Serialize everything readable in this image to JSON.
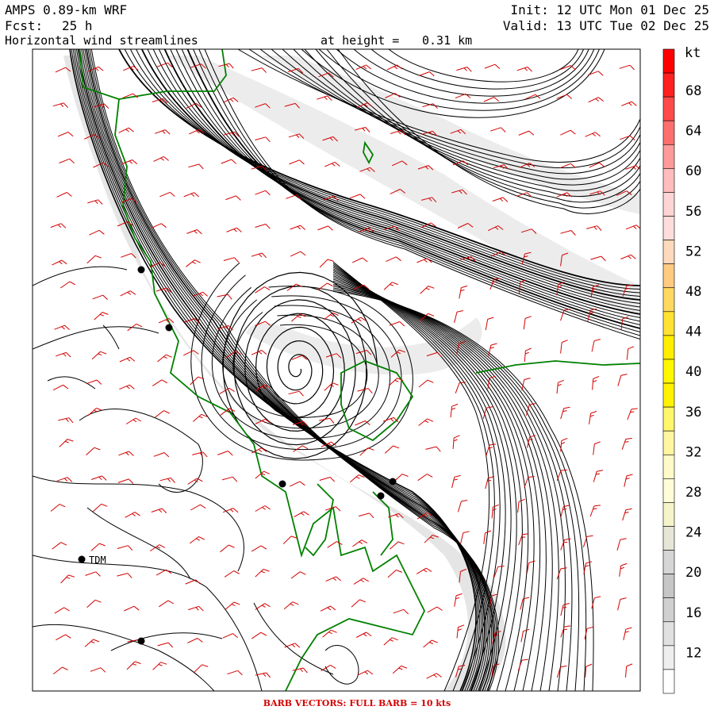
{
  "header": {
    "model": "AMPS 0.89-km WRF",
    "forecast_prefix": "Fcst:",
    "forecast_hours": "25 h",
    "field": "Horizontal wind streamlines",
    "height_prefix": "at height =",
    "height_value": "0.31 km",
    "init": "Init: 12 UTC Mon 01 Dec 25",
    "valid": "Valid: 13 UTC Tue 02 Dec 25"
  },
  "colorbar": {
    "unit": "kt",
    "ticks": [
      "68",
      "64",
      "60",
      "56",
      "52",
      "48",
      "44",
      "40",
      "36",
      "32",
      "28",
      "24",
      "20",
      "16",
      "12"
    ],
    "colors": [
      "#ff0000",
      "#ff2020",
      "#ff4a4a",
      "#ff6e6e",
      "#ff9a9a",
      "#ffbcbc",
      "#ffd4d4",
      "#ffdcdc",
      "#ffd9bb",
      "#ffcb80",
      "#ffd860",
      "#ffe233",
      "#ffee00",
      "#fff700",
      "#fff200",
      "#fff66a",
      "#fff6a0",
      "#fffac8",
      "#fffdd8",
      "#f4f4c8",
      "#e6e6d6",
      "#d6d6d6",
      "#c6c6c6",
      "#d0d0d0",
      "#e0e0e0",
      "#eeeeee",
      "#ffffff"
    ]
  },
  "map": {
    "station_label": "TDM",
    "streamline_color": "#000000",
    "coast_color": "#008000",
    "barb_color": "#d40000",
    "shade_color": "#cfcfcf"
  },
  "footer": {
    "text": "BARB VECTORS:  FULL BARB = 10 kts"
  }
}
